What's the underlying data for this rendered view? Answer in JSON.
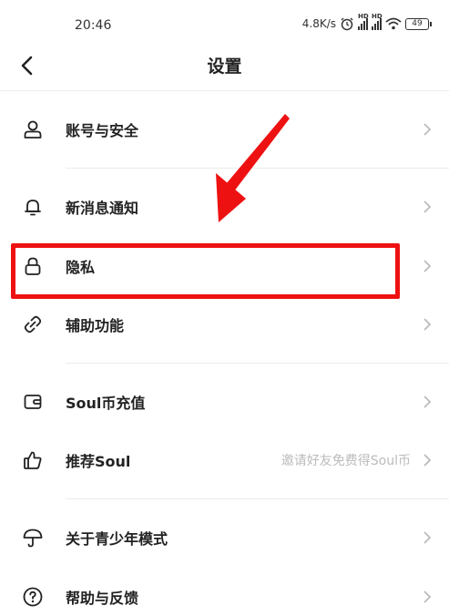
{
  "status_bar": {
    "time": "20:46",
    "speed": "4.8K/s",
    "battery": "49"
  },
  "nav": {
    "title": "设置"
  },
  "settings": [
    {
      "label": "账号与安全",
      "value": ""
    },
    {
      "label": "新消息通知",
      "value": ""
    },
    {
      "label": "隐私",
      "value": ""
    },
    {
      "label": "辅助功能",
      "value": ""
    },
    {
      "label": "Soul币充值",
      "value": ""
    },
    {
      "label": "推荐Soul",
      "value": "邀请好友免费得Soul币"
    },
    {
      "label": "关于青少年模式",
      "value": ""
    },
    {
      "label": "帮助与反馈",
      "value": ""
    }
  ],
  "colors": {
    "highlight": "#ee1111",
    "text": "#222222",
    "muted": "#bbbbbb"
  },
  "icons": [
    "user-icon",
    "bell-icon",
    "lock-icon",
    "link-icon",
    "wallet-icon",
    "thumbs-up-icon",
    "umbrella-icon",
    "help-icon",
    "chevron-right-icon"
  ]
}
